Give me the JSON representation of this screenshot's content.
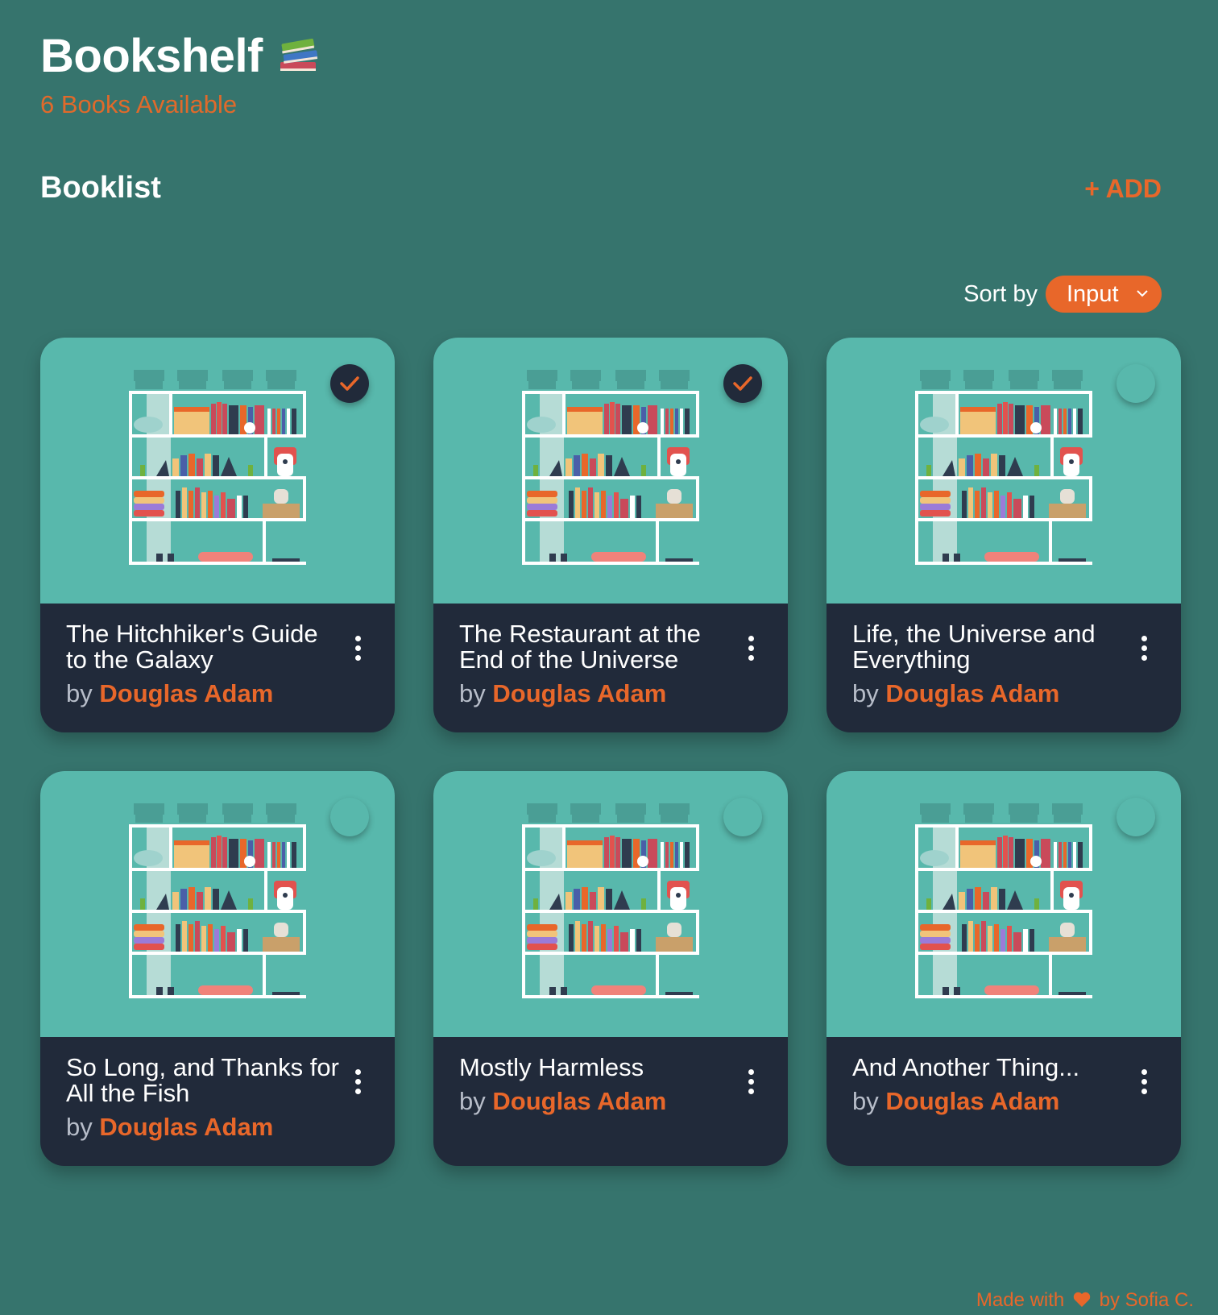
{
  "header": {
    "title": "Bookshelf",
    "emoji_icon": "books-icon",
    "subtitle": "6 Books Available"
  },
  "booklist": {
    "title": "Booklist",
    "add_label": "+ ADD"
  },
  "sort": {
    "label": "Sort by",
    "selected": "Input"
  },
  "books": [
    {
      "title": "The Hitchhiker's Guide to the Galaxy",
      "by": "by",
      "author": "Douglas Adam",
      "read": true
    },
    {
      "title": "The Restaurant at the End of the Universe",
      "by": "by",
      "author": "Douglas Adam",
      "read": true
    },
    {
      "title": "Life, the Universe and Everything",
      "by": "by",
      "author": "Douglas Adam",
      "read": false
    },
    {
      "title": "So Long, and Thanks for All the Fish",
      "by": "by",
      "author": "Douglas Adam",
      "read": false
    },
    {
      "title": "Mostly Harmless",
      "by": "by",
      "author": "Douglas Adam",
      "read": false
    },
    {
      "title": "And Another Thing...",
      "by": "by",
      "author": "Douglas Adam",
      "read": false
    }
  ],
  "footer": {
    "made_with": "Made with",
    "by_author": "by Sofia C."
  },
  "colors": {
    "background": "#36746d",
    "accent": "#e8672a",
    "card_image_bg": "#58b8ac",
    "card_body_bg": "#212a3a"
  }
}
